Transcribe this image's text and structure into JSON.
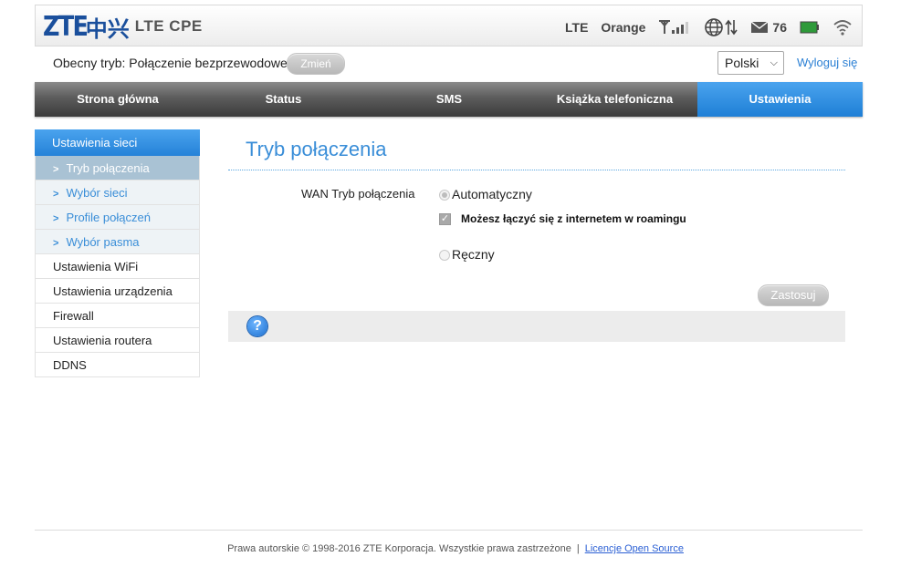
{
  "header": {
    "logo_text": "ZTE",
    "logo_cn": "中兴",
    "product": "LTE CPE",
    "network_type": "LTE",
    "operator": "Orange",
    "sms_count": "76",
    "icons": [
      "signal-icon",
      "globe-icon",
      "data-arrows-icon",
      "mail-icon",
      "battery-icon",
      "wifi-icon"
    ]
  },
  "modebar": {
    "mode_text": "Obecny tryb: Połączenie bezprzewodowe",
    "change_label": "Zmień",
    "language": "Polski",
    "logout_label": "Wyloguj się"
  },
  "nav": {
    "tabs": [
      {
        "label": "Strona główna"
      },
      {
        "label": "Status"
      },
      {
        "label": "SMS"
      },
      {
        "label": "Książka telefoniczna"
      },
      {
        "label": "Ustawienia"
      }
    ],
    "active": "Ustawienia"
  },
  "sidebar": {
    "items": [
      {
        "label": "Ustawienia sieci"
      },
      {
        "label": "Tryb połączenia"
      },
      {
        "label": "Wybór sieci"
      },
      {
        "label": "Profile połączeń"
      },
      {
        "label": "Wybór pasma"
      },
      {
        "label": "Ustawienia WiFi"
      },
      {
        "label": "Ustawienia urządzenia"
      },
      {
        "label": "Firewall"
      },
      {
        "label": "Ustawienia routera"
      },
      {
        "label": "DDNS"
      }
    ]
  },
  "main": {
    "title": "Tryb połączenia",
    "wan_label": "WAN Tryb połączenia",
    "option_auto": "Automatyczny",
    "roaming_label": "Możesz łączyć się z internetem w roamingu",
    "option_manual": "Ręczny",
    "apply_label": "Zastosuj"
  },
  "footer": {
    "copyright": "Prawa autorskie © 1998-2016 ZTE Korporacja. Wszystkie prawa zastrzeżone",
    "separator": "|",
    "license_link": "Licencje Open Source"
  },
  "colors": {
    "accent": "#2582d8",
    "nav_dark": "#3b3b3b",
    "link": "#2a7fd4"
  }
}
